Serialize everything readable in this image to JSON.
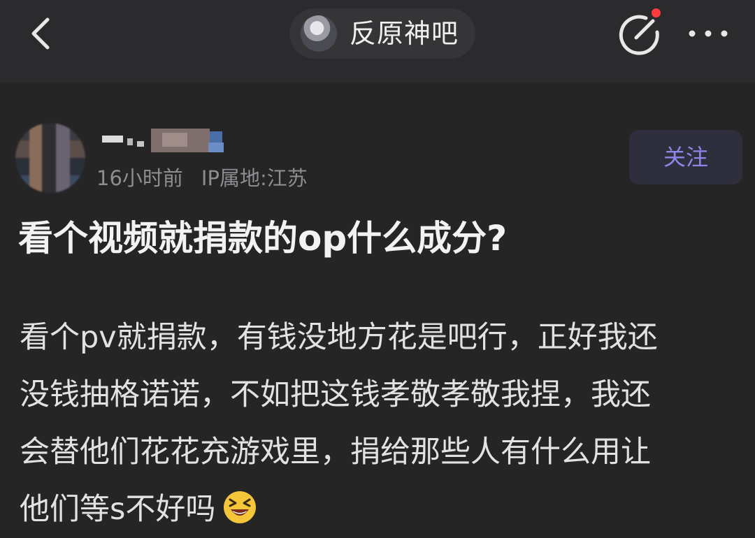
{
  "header": {
    "forum_name": "反原神吧",
    "notification": true
  },
  "post": {
    "time": "16小时前",
    "ip_location": "IP属地:江苏",
    "follow_label": "关注",
    "title": "看个视频就捐款的op什么成分?",
    "body_lines": [
      "看个pv就捐款，有钱没地方花是吧行，正好我还",
      "没钱抽格诺诺，不如把这钱孝敬孝敬我捏，我还",
      "会替他们花花充游戏里，捐给那些人有什么用让",
      "他们等s不好吗"
    ],
    "emoji": "grinning-squint-face"
  },
  "colors": {
    "background": "#252526",
    "header": "#2b2b2d",
    "accent": "#8d87e8",
    "notify": "#ff3b3b",
    "meta_text": "#8d8d92"
  }
}
